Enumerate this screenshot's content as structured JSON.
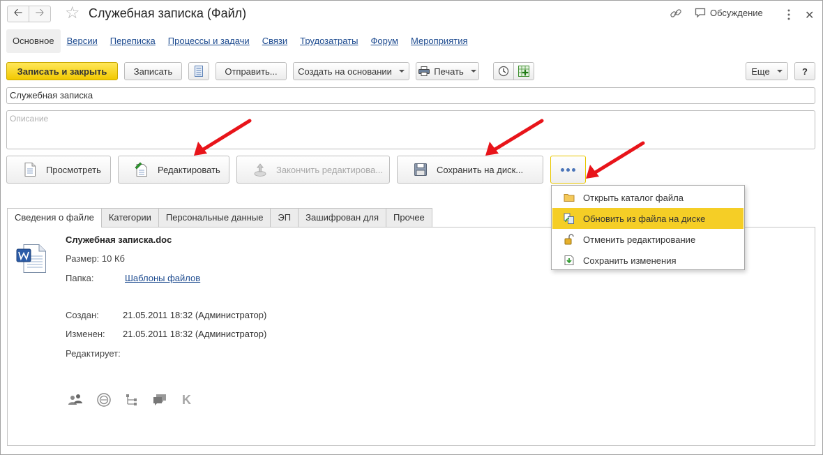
{
  "window": {
    "title": "Служебная записка (Файл)",
    "discussion_label": "Обсуждение"
  },
  "tabs": [
    {
      "label": "Основное"
    },
    {
      "label": "Версии"
    },
    {
      "label": "Переписка"
    },
    {
      "label": "Процессы и задачи"
    },
    {
      "label": "Связи"
    },
    {
      "label": "Трудозатраты"
    },
    {
      "label": "Форум"
    },
    {
      "label": "Мероприятия"
    }
  ],
  "toolbar": {
    "save_close": "Записать и закрыть",
    "save": "Записать",
    "send": "Отправить...",
    "create_based_on": "Создать на основании",
    "print": "Печать",
    "more": "Еще",
    "help": "?"
  },
  "fields": {
    "name_value": "Служебная записка",
    "description_placeholder": "Описание"
  },
  "actions": {
    "view": "Просмотреть",
    "edit": "Редактировать",
    "finish_edit": "Закончить редактирова...",
    "save_to_disk": "Сохранить на диск..."
  },
  "dropdown": {
    "items": [
      {
        "label": "Открыть каталог файла",
        "icon": "folder-icon"
      },
      {
        "label": "Обновить из файла на диске",
        "icon": "refresh-file-icon",
        "highlighted": true
      },
      {
        "label": "Отменить редактирование",
        "icon": "unlock-icon"
      },
      {
        "label": "Сохранить изменения",
        "icon": "save-changes-icon"
      }
    ]
  },
  "lower_tabs": [
    {
      "label": "Сведения о файле"
    },
    {
      "label": "Категории"
    },
    {
      "label": "Персональные данные"
    },
    {
      "label": "ЭП"
    },
    {
      "label": "Зашифрован для"
    },
    {
      "label": "Прочее"
    }
  ],
  "file_info": {
    "file_name": "Служебная записка.doc",
    "size": "Размер: 10 Кб",
    "folder_label": "Папка:",
    "folder_value": "Шаблоны файлов",
    "created_label": "Создан:",
    "created_value": "21.05.2011 18:32 (Администратор)",
    "modified_label": "Изменен:",
    "modified_value": "21.05.2011 18:32 (Администратор)",
    "editing_label": "Редактирует:"
  },
  "colors": {
    "accent_yellow": "#f5ce26",
    "link_blue": "#1c4a8f",
    "annotation_red": "#e8141a"
  }
}
